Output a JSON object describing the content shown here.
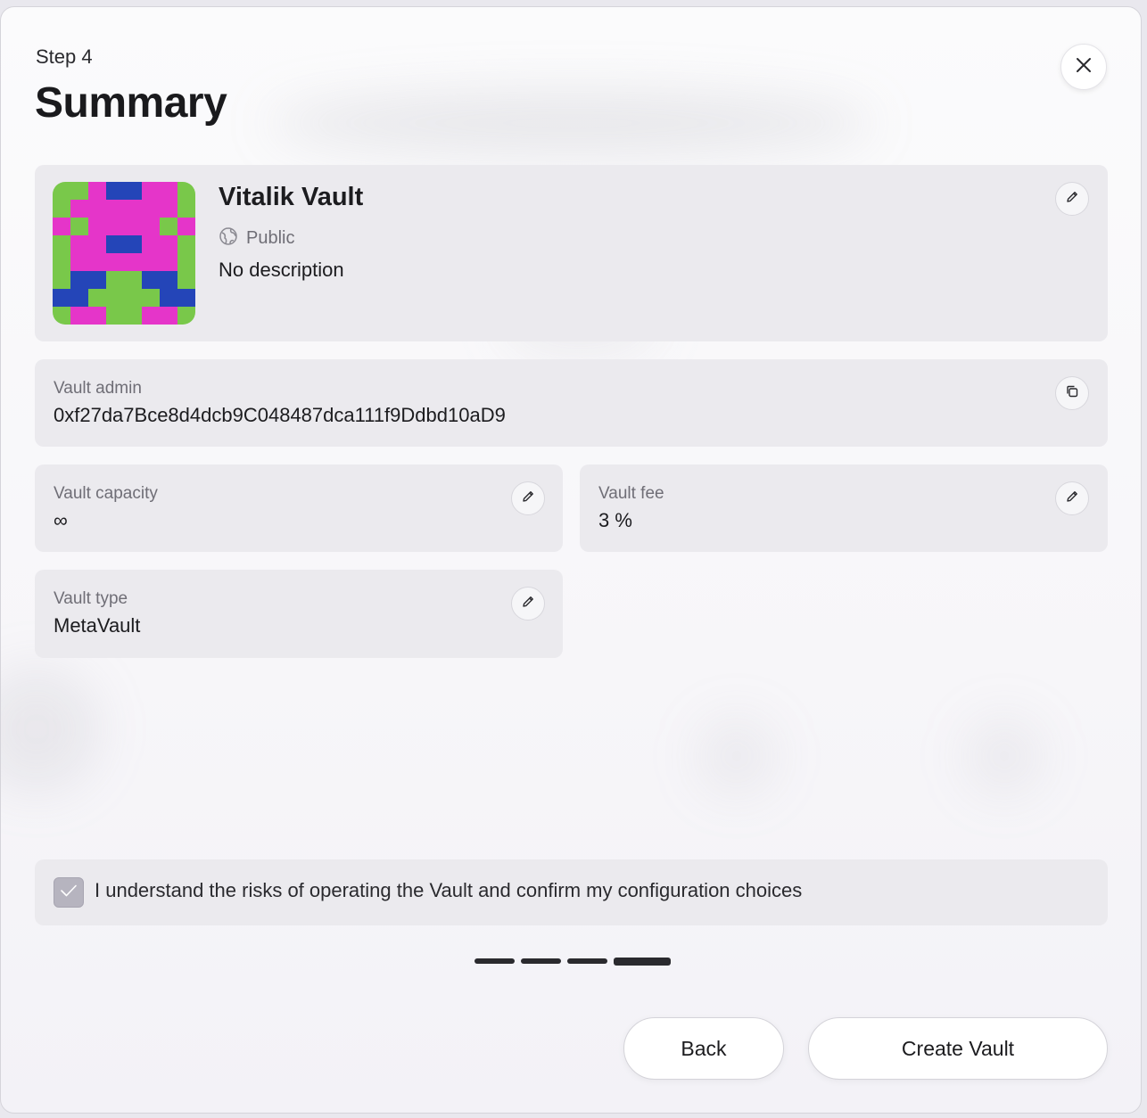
{
  "header": {
    "step_label": "Step 4",
    "title": "Summary",
    "close_icon": "close-icon"
  },
  "vault": {
    "name": "Vitalik Vault",
    "visibility": "Public",
    "visibility_icon": "globe-icon",
    "description": "No description",
    "avatar_colors": {
      "magenta": "#e535c9",
      "green": "#79c84a",
      "blue": "#2445b8"
    }
  },
  "admin": {
    "label": "Vault admin",
    "value": "0xf27da7Bce8d4dcb9C048487dca111f9Ddbd10aD9",
    "copy_icon": "copy-icon"
  },
  "capacity": {
    "label": "Vault capacity",
    "value": "∞"
  },
  "fee": {
    "label": "Vault fee",
    "value": "3 %"
  },
  "type": {
    "label": "Vault type",
    "value": "MetaVault"
  },
  "confirm": {
    "checked": true,
    "text": "I understand the risks of operating the Vault and confirm my configuration choices"
  },
  "progress": {
    "total_steps": 4,
    "current_step": 4
  },
  "buttons": {
    "back": "Back",
    "create": "Create Vault"
  }
}
